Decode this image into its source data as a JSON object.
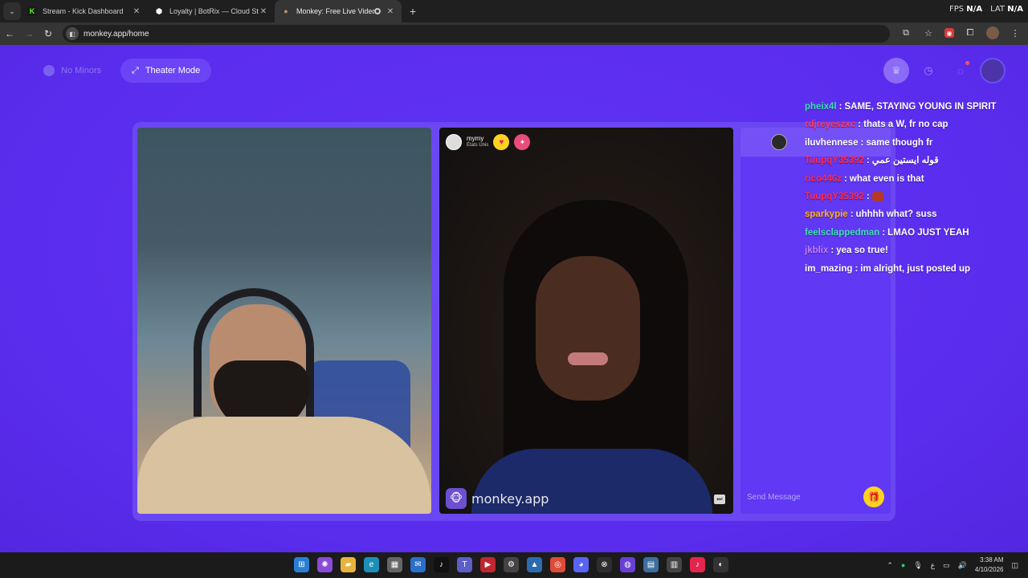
{
  "browser": {
    "tabs": [
      {
        "title": "Stream - Kick Dashboard",
        "favicon": "kick-icon",
        "color": "#53fc18"
      },
      {
        "title": "Loyalty | BotRix — Cloud Stream",
        "favicon": "botrix-icon",
        "color": "#ffffff"
      },
      {
        "title": "Monkey: Free Live Video Ch",
        "favicon": "monkey-icon",
        "color": "#c99060"
      }
    ],
    "new_tab": "+",
    "url": "monkey.app/home",
    "overlay": {
      "fps_label": "FPS",
      "fps_value": "N/A",
      "lat_label": "LAT",
      "lat_value": "N/A"
    }
  },
  "app": {
    "no_minors_label": "No Minors",
    "theater_mode_label": "Theater Mode",
    "peer": {
      "name": "mymy",
      "country": "États Unis"
    },
    "brand_label": "monkey.app",
    "send_placeholder": "Send Message",
    "accent": "#5b2cf0"
  },
  "chat": [
    {
      "user": "pheix4l",
      "text": "SAME, STAYING YOUNG IN SPIRIT",
      "color": "#3de0b0"
    },
    {
      "user": "rdjreyeszxc",
      "text": "thats a W, fr no cap",
      "color": "#ff3b6b"
    },
    {
      "user": "iluvhennese",
      "text": "same though fr",
      "color": "#ffffff"
    },
    {
      "user": "TuupqY35392",
      "text": "قوله ايستين عمي",
      "color": "#ff2a4a"
    },
    {
      "user": "rico446z",
      "text": "what even is that",
      "color": "#ff2a4a"
    },
    {
      "user": "TuupqY35392",
      "text": "",
      "color": "#ff2a4a",
      "emote": true
    },
    {
      "user": "sparkypie",
      "text": "uhhhh what? suss",
      "color": "#ffb020"
    },
    {
      "user": "feelsclappedman",
      "text": "LMAO JUST YEAH",
      "color": "#3de0b0"
    },
    {
      "user": "jkblix",
      "text": "yea so true!",
      "color": "#c07cff"
    },
    {
      "user": "im_mazing",
      "text": "im alright, just posted up",
      "color": "#ffffff"
    }
  ],
  "taskbar": {
    "time": "3:38 AM",
    "date": "4/10/2026",
    "lang": "ع"
  }
}
